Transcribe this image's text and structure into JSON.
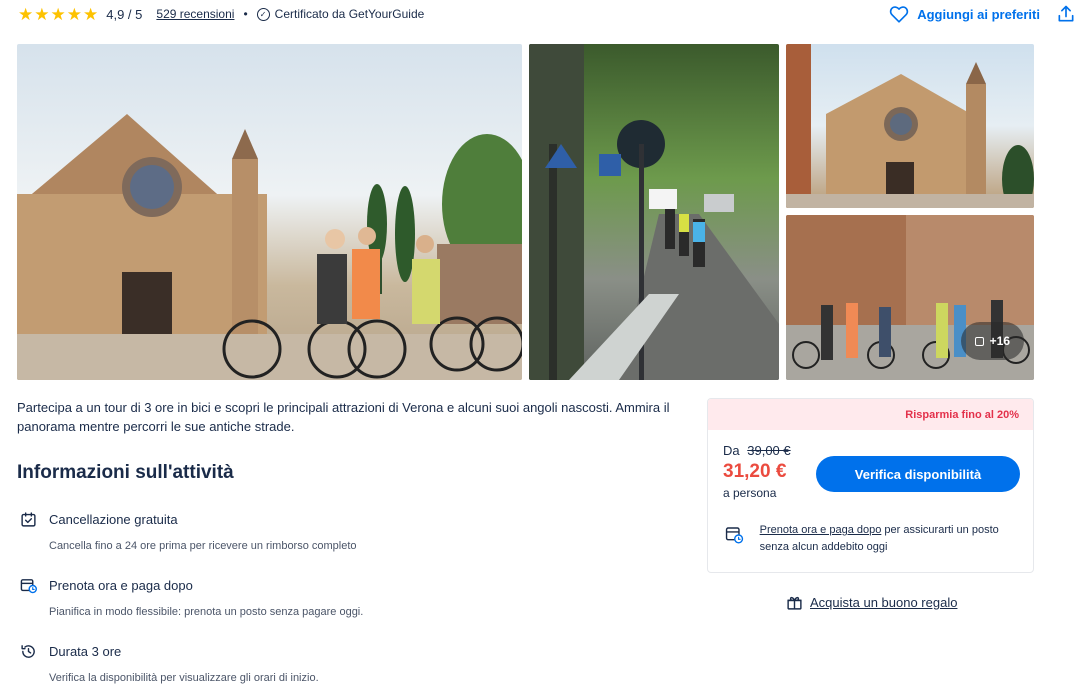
{
  "rating": {
    "stars": 5,
    "score": "4,9 / 5",
    "reviews": "529 recensioni",
    "separator": "•",
    "certified": "Certificato da GetYourGuide"
  },
  "actions": {
    "favorite": "Aggiungi ai preferiti"
  },
  "gallery": {
    "more_count": "+16"
  },
  "description": "Partecipa a un tour di 3 ore in bici e scopri le principali attrazioni di Verona e alcuni suoi angoli nascosti. Ammira il panorama mentre percorri le sue antiche strade.",
  "info": {
    "title": "Informazioni sull'attività",
    "items": [
      {
        "title": "Cancellazione gratuita",
        "text": "Cancella fino a 24 ore prima per ricevere un rimborso completo"
      },
      {
        "title": "Prenota ora e paga dopo",
        "text": "Pianifica in modo flessibile: prenota un posto senza pagare oggi."
      },
      {
        "title": "Durata 3 ore",
        "text": "Verifica la disponibilità per visualizzare gli orari di inizio."
      }
    ]
  },
  "booking": {
    "savings": "Risparmia fino al 20%",
    "from_label": "Da",
    "old_price": "39,00 €",
    "price": "31,20 €",
    "per": "a persona",
    "cta": "Verifica disponibilità",
    "paylater_link": "Prenota ora e paga dopo",
    "paylater_text": " per assicurarti un posto senza alcun addebito oggi"
  },
  "gift": {
    "label": "Acquista un buono regalo"
  },
  "colors": {
    "accent": "#0071eb",
    "price": "#eb4b3f",
    "savings_bg": "#ffeaed",
    "savings_text": "#e3314b",
    "star": "#fdc200",
    "text": "#1a2b49"
  }
}
